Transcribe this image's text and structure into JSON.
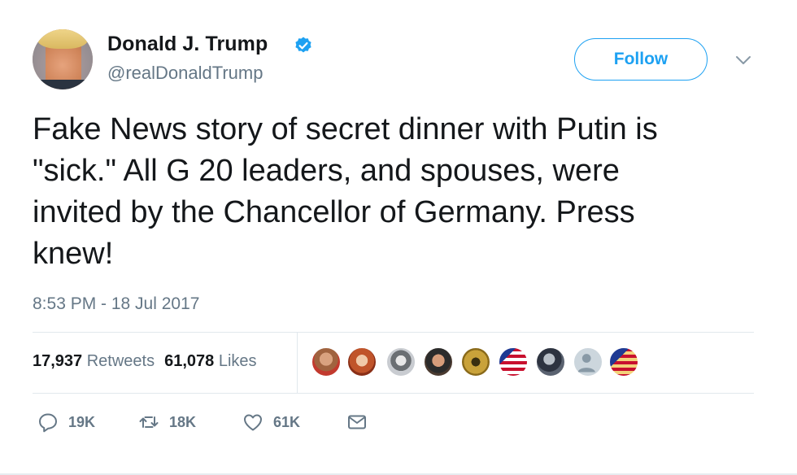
{
  "author": {
    "name": "Donald J. Trump",
    "handle": "@realDonaldTrump",
    "verified": true
  },
  "follow_button": {
    "label": "Follow"
  },
  "tweet": {
    "text": "Fake News story of secret dinner with Putin is\n\"sick.\" All G 20 leaders, and spouses, were\ninvited by the Chancellor of Germany. Press\nknew!",
    "timestamp": "8:53 PM - 18 Jul 2017"
  },
  "stats": {
    "retweets_count": "17,937",
    "retweets_label": "Retweets",
    "likes_count": "61,078",
    "likes_label": "Likes"
  },
  "likers": [
    {
      "icon": "liker-avatar-1"
    },
    {
      "icon": "liker-avatar-2"
    },
    {
      "icon": "liker-avatar-3"
    },
    {
      "icon": "liker-avatar-4"
    },
    {
      "icon": "liker-avatar-5"
    },
    {
      "icon": "liker-avatar-6-us-flag"
    },
    {
      "icon": "liker-avatar-7"
    },
    {
      "icon": "liker-avatar-8-default"
    },
    {
      "icon": "liker-avatar-9"
    }
  ],
  "actions": {
    "reply_count": "19K",
    "retweet_count": "18K",
    "like_count": "61K"
  },
  "colors": {
    "accent": "#1da1f2",
    "text": "#14171a",
    "secondary": "#657786",
    "border": "#e1e8ed"
  }
}
